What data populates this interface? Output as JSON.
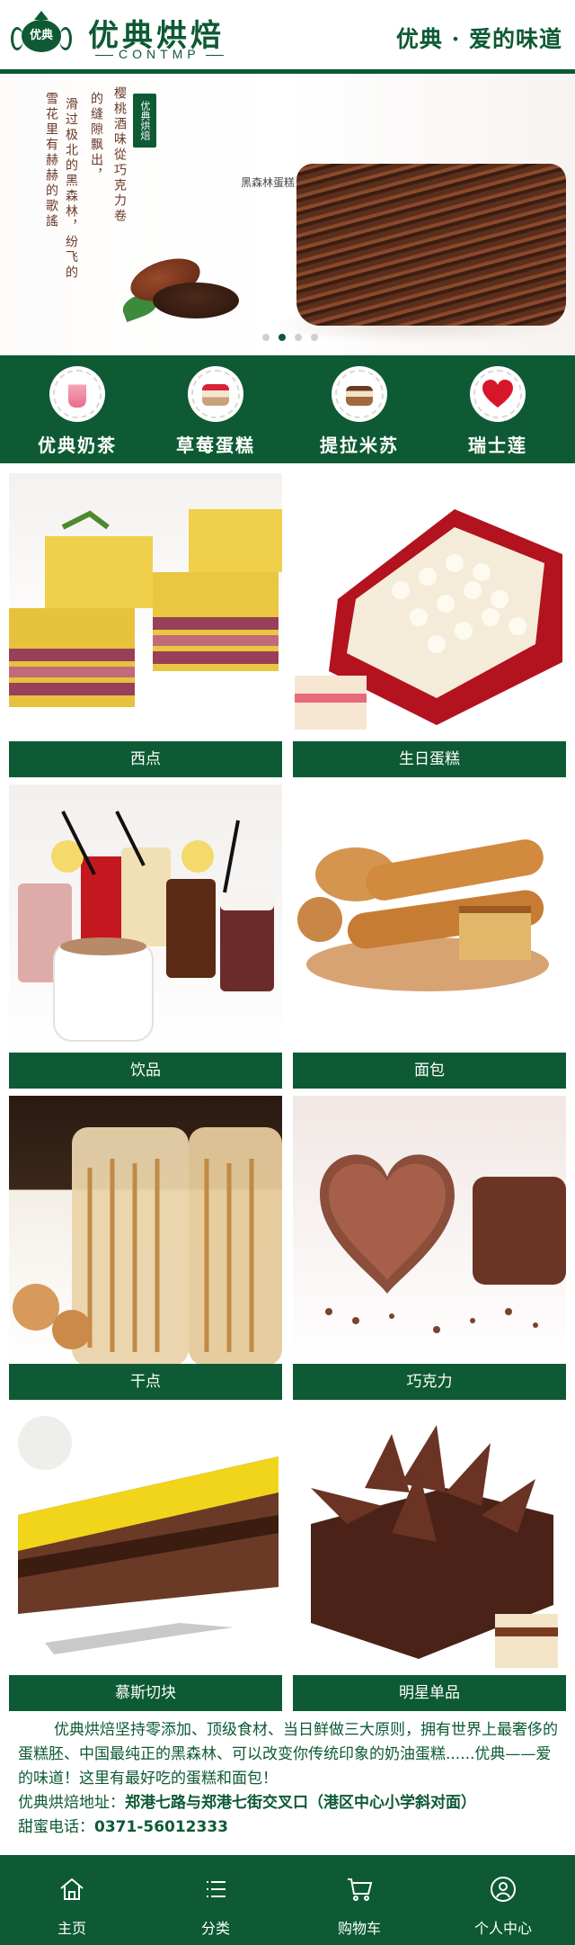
{
  "header": {
    "logo_text": "优典",
    "brand_name": "优典烘焙",
    "brand_sub": "CONTMP",
    "slogan": "优典 · 爱的味道"
  },
  "banner": {
    "tag": "优典烘焙",
    "poem_lines": [
      "樱桃酒味從巧克力卷",
      "的缝隙飘出，",
      "滑过极北的黑森林，纷飞的",
      "雪花里有赫赫的歌謠"
    ],
    "cake_label": "黑森林蛋糕",
    "slides": 4,
    "active_slide": 2
  },
  "categories": [
    {
      "label": "优典奶茶",
      "icon": "milk-tea-icon"
    },
    {
      "label": "草莓蛋糕",
      "icon": "strawberry-cake-icon"
    },
    {
      "label": "提拉米苏",
      "icon": "tiramisu-icon"
    },
    {
      "label": "瑞士莲",
      "icon": "heart-chocolate-icon"
    }
  ],
  "products": [
    {
      "name": "西点",
      "image": "layered-pastry-photo"
    },
    {
      "name": "生日蛋糕",
      "image": "birthday-cake-photo"
    },
    {
      "name": "饮品",
      "image": "drinks-photo"
    },
    {
      "name": "面包",
      "image": "bread-photo"
    },
    {
      "name": "干点",
      "image": "dry-snacks-photo"
    },
    {
      "name": "巧克力",
      "image": "chocolate-photo"
    },
    {
      "name": "慕斯切块",
      "image": "mousse-slice-photo"
    },
    {
      "name": "明星单品",
      "image": "star-product-photo"
    }
  ],
  "intro": {
    "text": "优典烘焙坚持零添加、顶级食材、当日鲜做三大原则，拥有世界上最奢侈的蛋糕胚、中国最纯正的黑森林、可以改变你传统印象的奶油蛋糕......优典——爱的味道！这里有最好吃的蛋糕和面包！",
    "address_label": "优典烘焙地址：",
    "address": "郑港七路与郑港七街交叉口（港区中心小学斜对面）",
    "phone_label": "甜蜜电话：",
    "phone": "0371-56012333"
  },
  "tabbar": [
    {
      "label": "主页",
      "icon": "home-icon"
    },
    {
      "label": "分类",
      "icon": "list-icon"
    },
    {
      "label": "购物车",
      "icon": "cart-icon"
    },
    {
      "label": "个人中心",
      "icon": "user-icon"
    }
  ],
  "colors": {
    "brand_green": "#0d5a34",
    "white": "#ffffff"
  }
}
